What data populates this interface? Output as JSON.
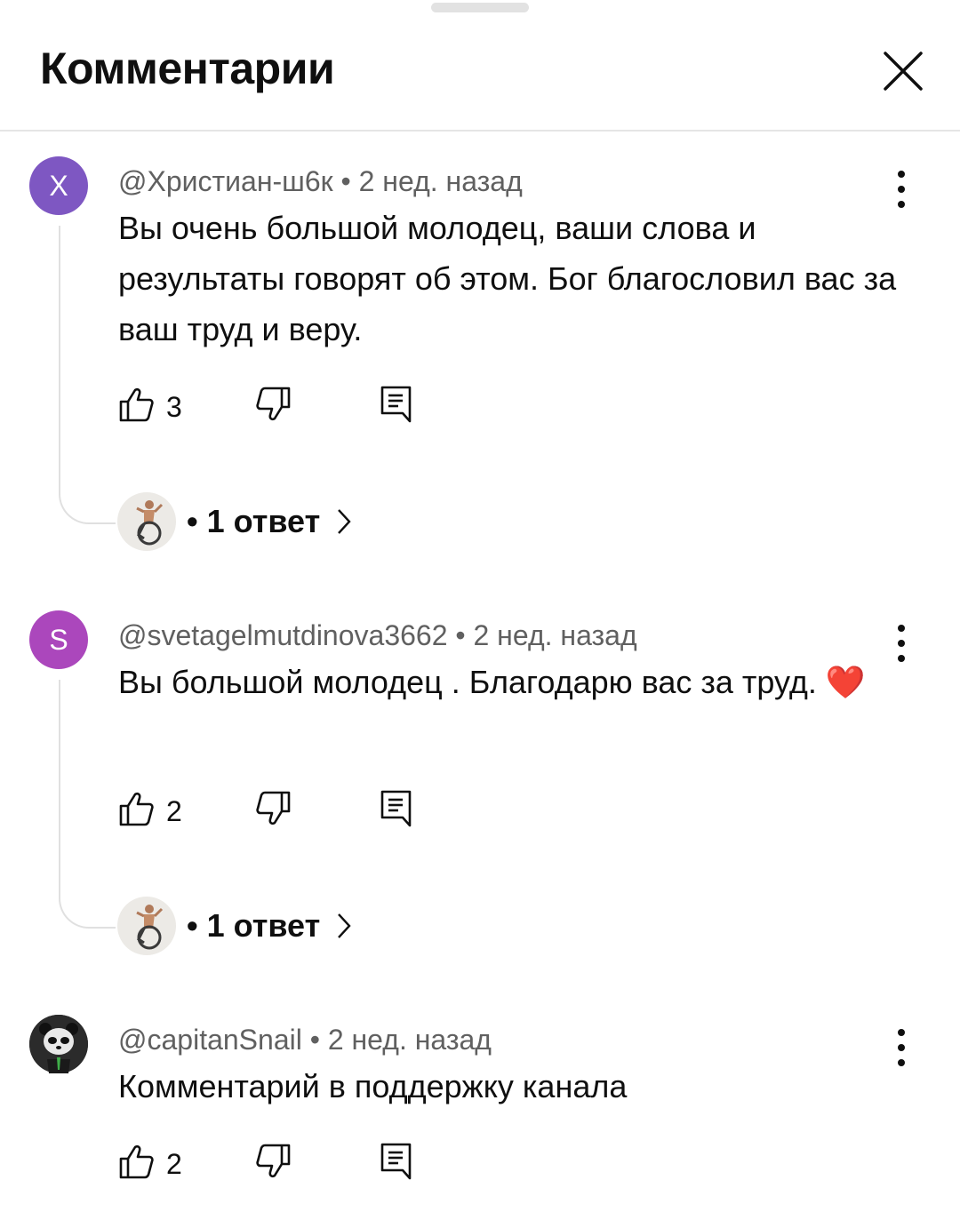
{
  "header": {
    "title": "Комментарии"
  },
  "comments": [
    {
      "avatar_letter": "Х",
      "avatar_color": "#7e57c2",
      "author": "@Христиан-ш6к",
      "time": "2 нед. назад",
      "text": "Вы очень большой молодец, ваши слова и результаты говорят об этом. Бог благословил вас за ваш труд и веру.",
      "likes": "3",
      "replies_label": "1 ответ"
    },
    {
      "avatar_letter": "S",
      "avatar_color": "#ab47bc",
      "author": "@svetagelmutdinova3662",
      "time": "2 нед. назад",
      "text": "Вы большой молодец . Благодарю вас за труд. ❤️",
      "likes": "2",
      "replies_label": "1 ответ"
    },
    {
      "avatar_icon": "panda-icon",
      "author": "@capitanSnail",
      "time": "2 нед. назад",
      "text": "Комментарий в поддержку канала",
      "likes": "2"
    }
  ],
  "separator": "•"
}
